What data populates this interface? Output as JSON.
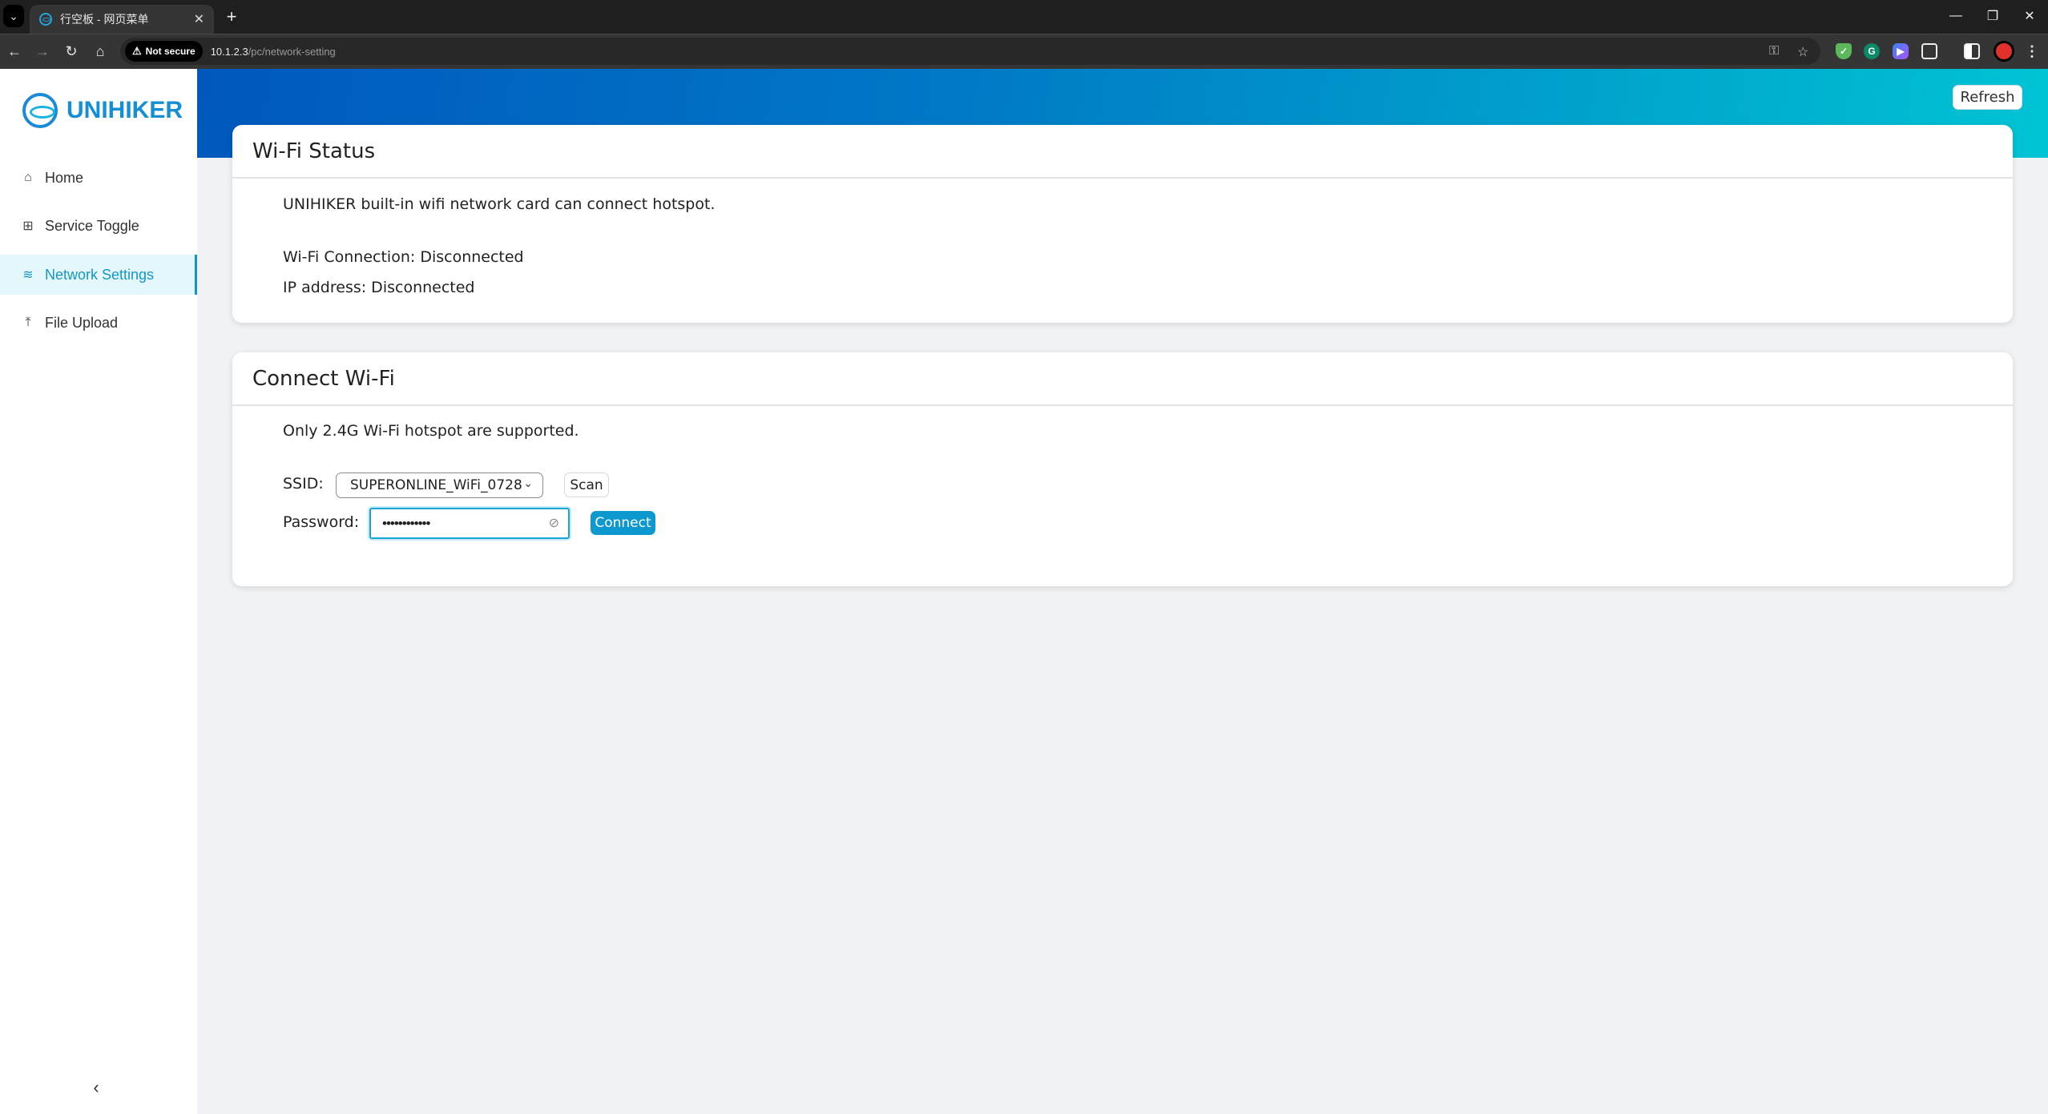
{
  "browser": {
    "tab_title": "行空板 - 网页菜单",
    "security_label": "Not secure",
    "url_host": "10.1.2.3",
    "url_path": "/pc/network-setting",
    "extension_icons": [
      "adblock-shield-icon",
      "grammarly-icon",
      "copilot-icon",
      "extensions-puzzle-icon"
    ]
  },
  "sidebar": {
    "logo_text": "UNIHIKER",
    "items": [
      {
        "label": "Home",
        "icon": "home-icon",
        "active": false
      },
      {
        "label": "Service Toggle",
        "icon": "grid-icon",
        "active": false
      },
      {
        "label": "Network Settings",
        "icon": "wifi-icon",
        "active": true
      },
      {
        "label": "File Upload",
        "icon": "upload-icon",
        "active": false
      }
    ],
    "collapse_glyph": "‹"
  },
  "header": {
    "refresh_label": "Refresh",
    "gradient_start": "#0058bd",
    "gradient_end": "#00c4d4"
  },
  "wifi_status": {
    "title": "Wi-Fi Status",
    "description": "UNIHIKER built-in wifi network card can connect hotspot.",
    "connection": "Wi-Fi Connection: Disconnected",
    "ip_address": "IP address: Disconnected"
  },
  "connect_wifi": {
    "title": "Connect Wi-Fi",
    "note": "Only 2.4G Wi-Fi hotspot are supported.",
    "ssid_label": "SSID:",
    "ssid_value": "SUPERONLINE_WiFi_0728",
    "scan_label": "Scan",
    "password_label": "Password:",
    "password_value": "••••••••••••",
    "connect_label": "Connect",
    "accent_color": "#0d98cf"
  }
}
